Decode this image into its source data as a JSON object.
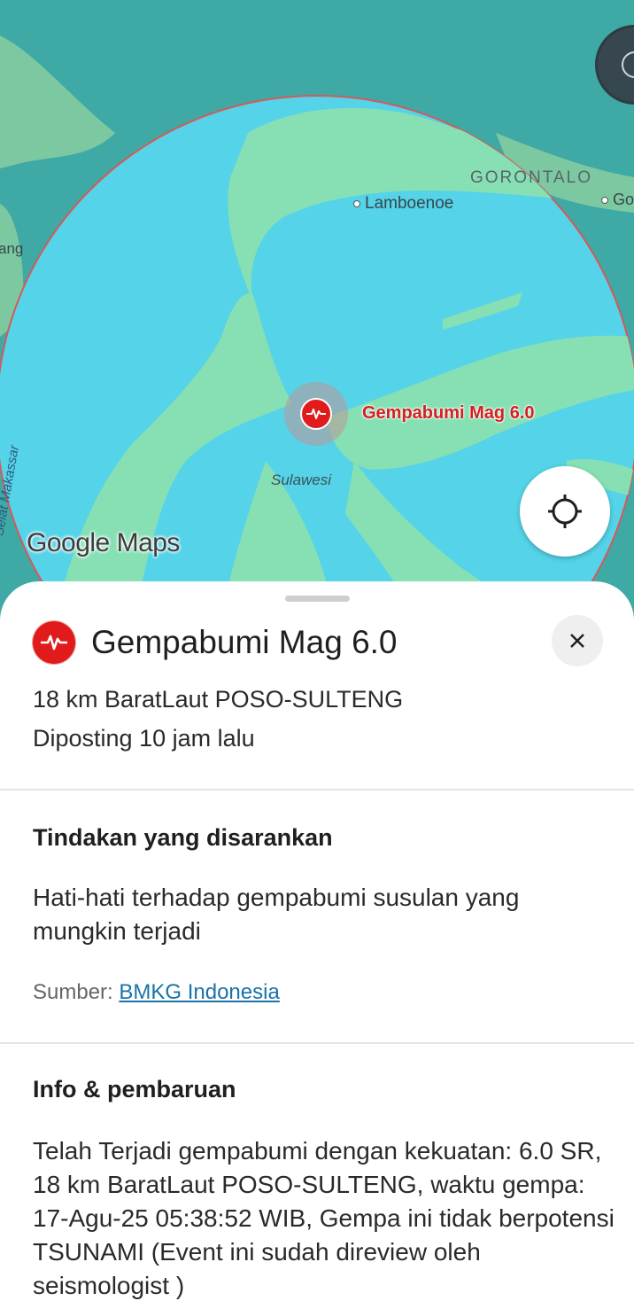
{
  "map": {
    "place_labels": {
      "gorontalo": "GORONTALO",
      "lamboenoe": "Lamboenoe",
      "go_cut": "Go",
      "ang_cut": "ang",
      "sulawesi": "Sulawesi",
      "selat": "Selat Makassar"
    },
    "quake_label": "Gempabumi Mag 6.0",
    "attribution": "Google Maps",
    "colors": {
      "sea": "#3fa9a5",
      "radius_fill": "#55d3e8",
      "land": "#7fdcb0",
      "radius_border": "#d45a5a"
    }
  },
  "sheet": {
    "title": "Gempabumi Mag 6.0",
    "location": "18 km BaratLaut POSO-SULTENG",
    "posted": "Diposting 10 jam lalu",
    "section_action": {
      "heading": "Tindakan yang disarankan",
      "body": "Hati-hati terhadap gempabumi susulan yang mungkin terjadi",
      "source_prefix": "Sumber: ",
      "source_link": "BMKG Indonesia"
    },
    "section_info": {
      "heading": "Info & pembaruan",
      "body": "Telah Terjadi gempabumi dengan kekuatan: 6.0 SR, 18 km BaratLaut POSO-SULTENG, waktu gempa: 17-Agu-25 05:38:52 WIB, Gempa ini tidak berpotensi TSUNAMI (Event ini sudah direview oleh seismologist )"
    },
    "icons": {
      "quake": "seismic-wave-icon",
      "close": "close-icon",
      "locate": "my-location-icon",
      "compass": "compass-icon"
    },
    "colors": {
      "alert_red": "#e11b1b",
      "link": "#1a73a8"
    }
  }
}
